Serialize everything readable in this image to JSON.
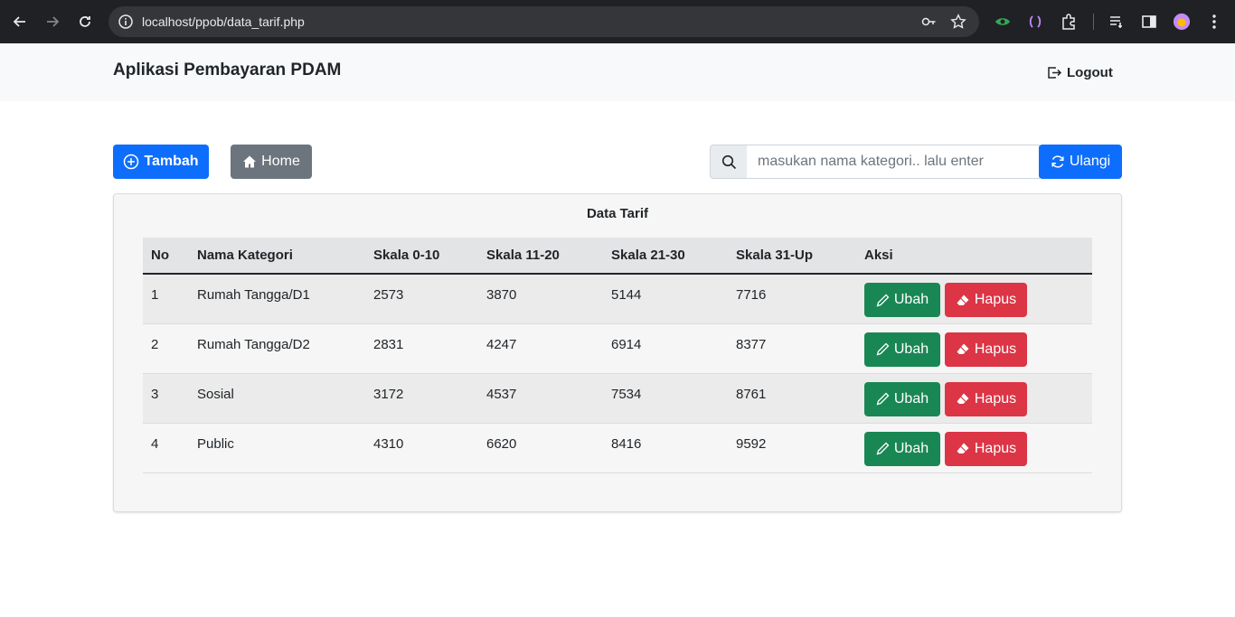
{
  "browser": {
    "url": "localhost/ppob/data_tarif.php"
  },
  "app": {
    "brand": "Aplikasi Pembayaran PDAM",
    "logout_label": "Logout"
  },
  "toolbar": {
    "tambah_label": "Tambah",
    "home_label": "Home",
    "search_placeholder": "masukan nama kategori.. lalu enter",
    "ulangi_label": "Ulangi"
  },
  "card": {
    "title": "Data Tarif",
    "columns": [
      "No",
      "Nama Kategori",
      "Skala 0-10",
      "Skala 11-20",
      "Skala 21-30",
      "Skala 31-Up",
      "Aksi"
    ],
    "rows": [
      {
        "no": "1",
        "nama": "Rumah Tangga/D1",
        "s1": "2573",
        "s2": "3870",
        "s3": "5144",
        "s4": "7716"
      },
      {
        "no": "2",
        "nama": "Rumah Tangga/D2",
        "s1": "2831",
        "s2": "4247",
        "s3": "6914",
        "s4": "8377"
      },
      {
        "no": "3",
        "nama": "Sosial",
        "s1": "3172",
        "s2": "4537",
        "s3": "7534",
        "s4": "8761"
      },
      {
        "no": "4",
        "nama": "Public",
        "s1": "4310",
        "s2": "6620",
        "s3": "8416",
        "s4": "9592"
      }
    ],
    "ubah_label": "Ubah",
    "hapus_label": "Hapus"
  },
  "colors": {
    "primary": "#0d6efd",
    "secondary": "#6c757d",
    "success": "#198754",
    "danger": "#dc3545"
  }
}
